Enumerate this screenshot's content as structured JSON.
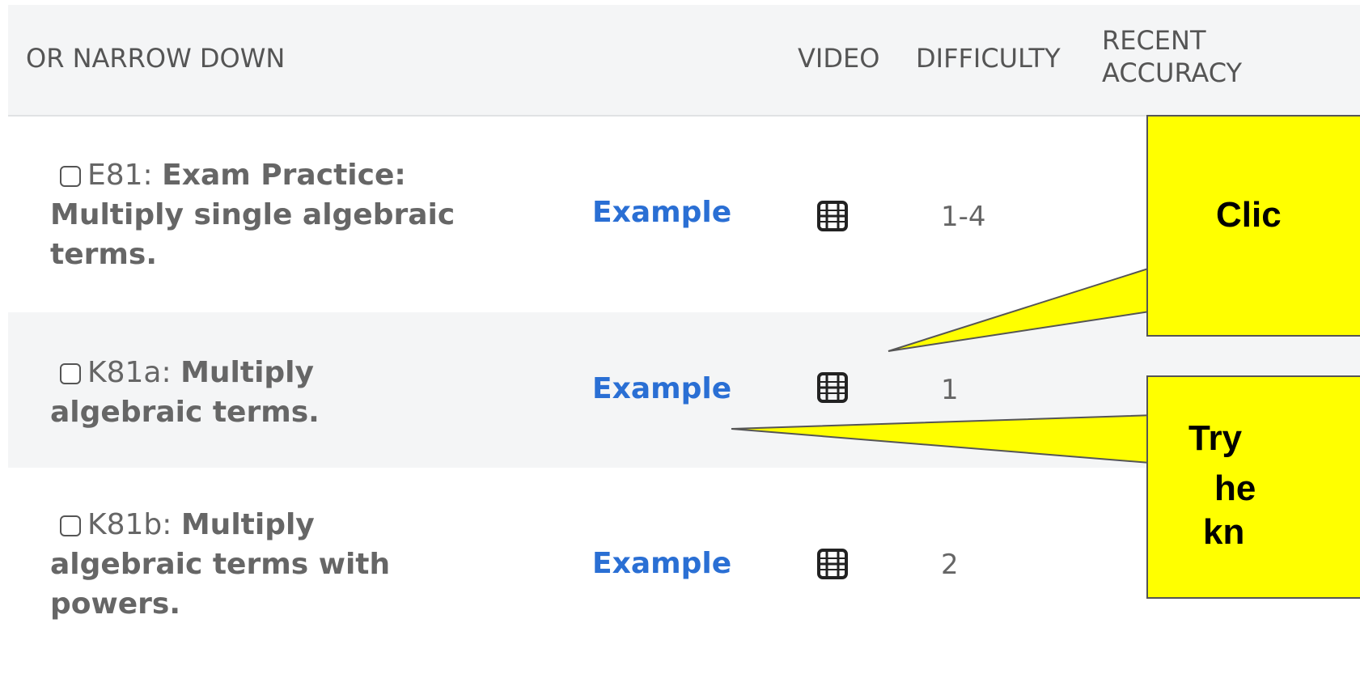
{
  "header": {
    "narrow_down": "OR NARROW DOWN",
    "video": "VIDEO",
    "difficulty": "DIFFICULTY",
    "recent_line1": "RECENT",
    "recent_line2": "ACCURACY"
  },
  "rows": [
    {
      "code": "E81:",
      "title_lines": [
        "Exam Practice:",
        "Multiply single algebraic",
        "terms."
      ],
      "example_label": "Example",
      "video_icon": "film-icon",
      "difficulty": "1-4"
    },
    {
      "code": "K81a:",
      "title_lines": [
        "Multiply",
        "algebraic terms."
      ],
      "example_label": "Example",
      "video_icon": "film-icon",
      "difficulty": "1"
    },
    {
      "code": "K81b:",
      "title_lines": [
        "Multiply",
        "algebraic terms with",
        "powers."
      ],
      "example_label": "Example",
      "video_icon": "film-icon",
      "difficulty": "2"
    }
  ],
  "callouts": [
    {
      "text": "Clic"
    },
    {
      "lines": [
        "Try",
        "he",
        "kn"
      ]
    }
  ],
  "colors": {
    "accent_link": "#2a6fd4",
    "callout_fill": "#ffff00",
    "header_bg": "#f4f5f6"
  }
}
